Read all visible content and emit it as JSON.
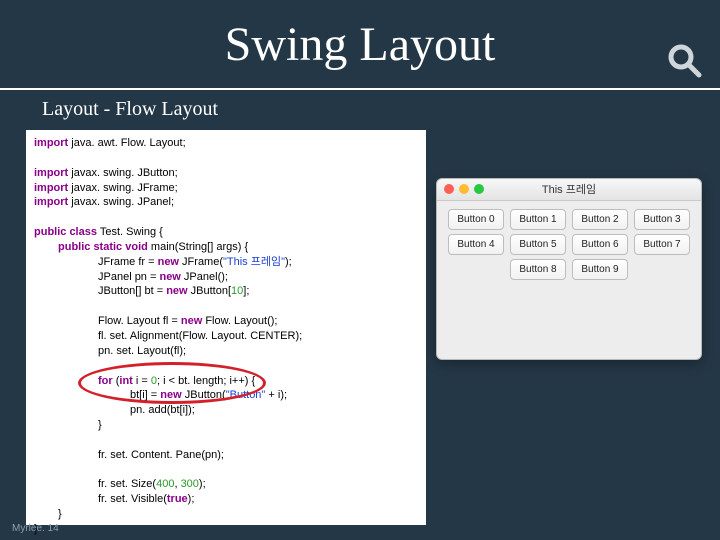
{
  "header": {
    "title": "Swing Layout"
  },
  "subtitle": "Layout - Flow Layout",
  "code": {
    "imp": "import",
    "l1": " java. awt. Flow. Layout;",
    "l2": " javax. swing. JButton;",
    "l3": " javax. swing. JFrame;",
    "l4": " javax. swing. JPanel;",
    "pc": "public class",
    "cls": " Test. Swing {",
    "psv": "public static void",
    "main": " main(String[] args) {",
    "fr1a": "JFrame fr = ",
    "newkw": "new",
    "fr1b": " JFrame(",
    "str1": "\"This 프레임\"",
    "fr1c": ");",
    "pn1a": "JPanel pn = ",
    "pn1b": " JPanel();",
    "bt1a": "JButton[] bt = ",
    "bt1b": " JButton[",
    "num10": "10",
    "bt1c": "];",
    "fl1a": "Flow. Layout fl = ",
    "fl1b": " Flow. Layout();",
    "fl2": "fl. set. Alignment(Flow. Layout. CENTER);",
    "fl3": "pn. set. Layout(fl);",
    "forkw": "for",
    "for1a": " (",
    "intkw": "int",
    "for1b": " i = ",
    "num0": "0",
    "for1c": "; i < bt. length; i++) {",
    "bti1a": "bt[i] = ",
    "bti1b": " JButton(",
    "str2": "\"Button\"",
    "bti1c": " + i);",
    "add": "pn. add(bt[i]);",
    "cb": "}",
    "scp": "fr. set. Content. Pane(pn);",
    "ss1a": "fr. set. Size(",
    "num400": "400",
    "comma": ", ",
    "num300": "300",
    "ss1b": ");",
    "sv1a": "fr. set. Visible(",
    "truekw": "true",
    "sv1b": ");"
  },
  "window": {
    "title": "This 프레임",
    "buttons": [
      "Button 0",
      "Button 1",
      "Button 2",
      "Button 3",
      "Button 4",
      "Button 5",
      "Button 6",
      "Button 7",
      "Button 8",
      "Button 9"
    ]
  },
  "watermark": "Myrlee. 14"
}
